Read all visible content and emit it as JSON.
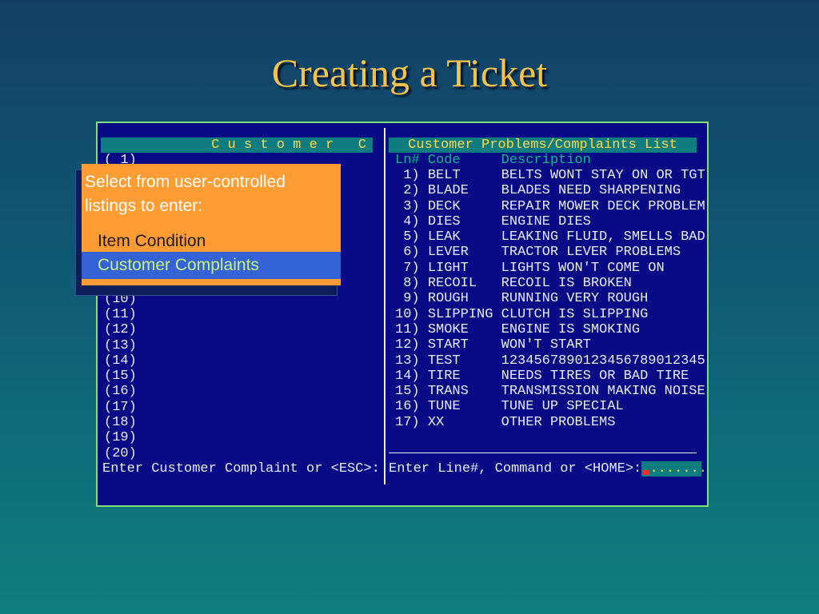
{
  "slide": {
    "title": "Creating a Ticket"
  },
  "left_pane": {
    "header": "C u s t o m e r   C",
    "rows": [
      "( 1)",
      "(10)",
      "(11)",
      "(12)",
      "(13)",
      "(14)",
      "(15)",
      "(16)",
      "(17)",
      "(18)",
      "(19)",
      "(20)"
    ],
    "prompt": "Enter Customer Complaint or <ESC>:"
  },
  "right_pane": {
    "header": "Customer Problems/Complaints List",
    "columns": {
      "ln": "Ln#",
      "code": "Code",
      "description": "Description"
    },
    "rows": [
      {
        "ln": " 1)",
        "code": "BELT",
        "description": "BELTS WONT STAY ON OR TGT"
      },
      {
        "ln": " 2)",
        "code": "BLADE",
        "description": "BLADES NEED SHARPENING"
      },
      {
        "ln": " 3)",
        "code": "DECK",
        "description": "REPAIR MOWER DECK PROBLEM"
      },
      {
        "ln": " 4)",
        "code": "DIES",
        "description": "ENGINE DIES"
      },
      {
        "ln": " 5)",
        "code": "LEAK",
        "description": "LEAKING FLUID, SMELLS BAD"
      },
      {
        "ln": " 6)",
        "code": "LEVER",
        "description": "TRACTOR LEVER PROBLEMS"
      },
      {
        "ln": " 7)",
        "code": "LIGHT",
        "description": "LIGHTS WON'T COME ON"
      },
      {
        "ln": " 8)",
        "code": "RECOIL",
        "description": "RECOIL IS BROKEN"
      },
      {
        "ln": " 9)",
        "code": "ROUGH",
        "description": "RUNNING VERY ROUGH"
      },
      {
        "ln": "10)",
        "code": "SLIPPING",
        "description": "CLUTCH IS SLIPPING"
      },
      {
        "ln": "11)",
        "code": "SMOKE",
        "description": "ENGINE IS SMOKING"
      },
      {
        "ln": "12)",
        "code": "START",
        "description": "WON'T START"
      },
      {
        "ln": "13)",
        "code": "TEST",
        "description": "1234567890123456789012345"
      },
      {
        "ln": "14)",
        "code": "TIRE",
        "description": "NEEDS TIRES OR BAD TIRE"
      },
      {
        "ln": "15)",
        "code": "TRANS",
        "description": "TRANSMISSION MAKING NOISE"
      },
      {
        "ln": "16)",
        "code": "TUNE",
        "description": "TUNE UP SPECIAL"
      },
      {
        "ln": "17)",
        "code": "XX",
        "description": "OTHER PROBLEMS"
      }
    ],
    "prompt": "Enter Line#, Command or <HOME>:",
    "input_value": "........"
  },
  "callout": {
    "line1": "Select from user-controlled",
    "line2": "listings to enter:",
    "item1": "Item Condition",
    "item2": "Customer Complaints"
  }
}
